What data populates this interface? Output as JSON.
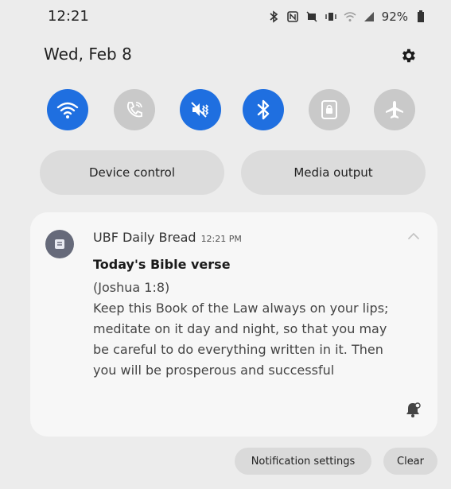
{
  "status_bar": {
    "time": "12:21",
    "battery": "92%",
    "icons": [
      "bluetooth-icon",
      "nfc-icon",
      "mute-icon",
      "vibrate-icon",
      "wifi-icon",
      "signal-icon",
      "battery-icon"
    ]
  },
  "header": {
    "date": "Wed, Feb 8",
    "settings_icon": "gear-icon"
  },
  "quick_tiles": [
    {
      "name": "wifi",
      "icon": "wifi-icon",
      "state": "on"
    },
    {
      "name": "wifi-calling",
      "icon": "wifi-call-icon",
      "state": "off"
    },
    {
      "name": "sound",
      "icon": "vibrate-icon",
      "state": "on"
    },
    {
      "name": "bluetooth",
      "icon": "bluetooth-icon",
      "state": "on"
    },
    {
      "name": "lock",
      "icon": "lock-icon",
      "state": "off"
    },
    {
      "name": "airplane",
      "icon": "airplane-icon",
      "state": "off"
    }
  ],
  "controls": {
    "device_control": "Device control",
    "media_output": "Media output"
  },
  "notification": {
    "app_name": "UBF Daily Bread",
    "time": "12:21 PM",
    "title": "Today's Bible verse",
    "reference": "(Joshua 1:8)",
    "lines": [
      "Keep this Book of the Law always on your lips;",
      "meditate on it day and night, so that you may",
      "be careful to do everything written in it. Then",
      "you will be prosperous and successful"
    ]
  },
  "footer": {
    "notification_settings": "Notification settings",
    "clear": "Clear"
  },
  "colors": {
    "tile_on": "#1f6fe0",
    "tile_off": "#c9c9c9",
    "background": "#ececec",
    "card": "#f7f7f7"
  }
}
